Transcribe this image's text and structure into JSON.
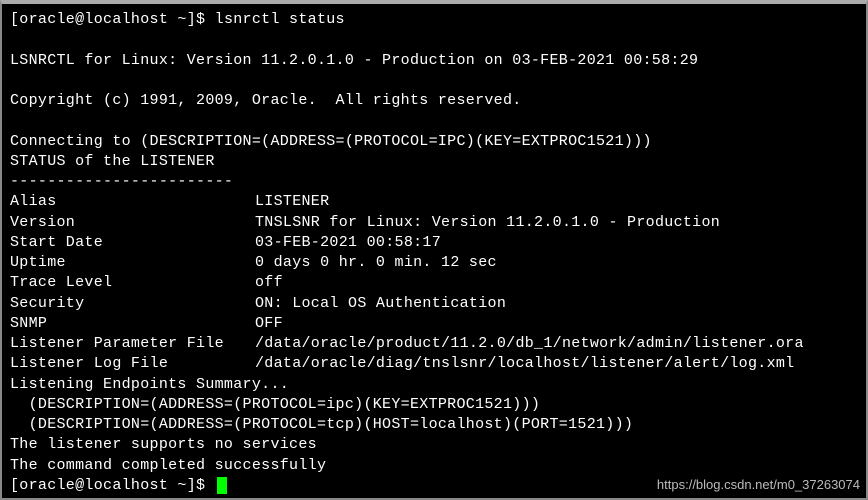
{
  "prompt": "[oracle@localhost ~]$ ",
  "command": "lsnrctl status",
  "banner": "LSNRCTL for Linux: Version 11.2.0.1.0 - Production on 03-FEB-2021 00:58:29",
  "copyright": "Copyright (c) 1991, 2009, Oracle.  All rights reserved.",
  "connecting": "Connecting to (DESCRIPTION=(ADDRESS=(PROTOCOL=IPC)(KEY=EXTPROC1521)))",
  "status_header": "STATUS of the LISTENER",
  "divider": "------------------------",
  "fields": {
    "alias": {
      "label": "Alias",
      "value": "LISTENER"
    },
    "version": {
      "label": "Version",
      "value": "TNSLSNR for Linux: Version 11.2.0.1.0 - Production"
    },
    "start_date": {
      "label": "Start Date",
      "value": "03-FEB-2021 00:58:17"
    },
    "uptime": {
      "label": "Uptime",
      "value": "0 days 0 hr. 0 min. 12 sec"
    },
    "trace_level": {
      "label": "Trace Level",
      "value": "off"
    },
    "security": {
      "label": "Security",
      "value": "ON: Local OS Authentication"
    },
    "snmp": {
      "label": "SNMP",
      "value": "OFF"
    },
    "param_file": {
      "label": "Listener Parameter File",
      "value": "/data/oracle/product/11.2.0/db_1/network/admin/listener.ora"
    },
    "log_file": {
      "label": "Listener Log File",
      "value": "/data/oracle/diag/tnslsnr/localhost/listener/alert/log.xml"
    }
  },
  "endpoints_header": "Listening Endpoints Summary...",
  "endpoints": [
    "  (DESCRIPTION=(ADDRESS=(PROTOCOL=ipc)(KEY=EXTPROC1521)))",
    "  (DESCRIPTION=(ADDRESS=(PROTOCOL=tcp)(HOST=localhost)(PORT=1521)))"
  ],
  "supports_line": "The listener supports no services",
  "completed_line": "The command completed successfully",
  "prompt2": "[oracle@localhost ~]$ ",
  "watermark": "https://blog.csdn.net/m0_37263074"
}
